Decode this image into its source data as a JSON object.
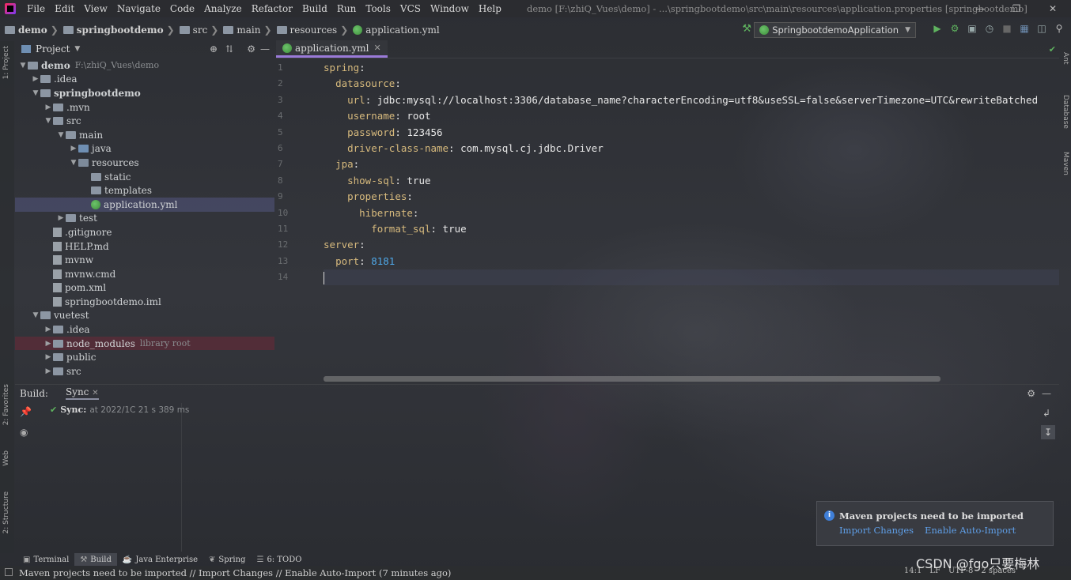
{
  "menu": [
    "File",
    "Edit",
    "View",
    "Navigate",
    "Code",
    "Analyze",
    "Refactor",
    "Build",
    "Run",
    "Tools",
    "VCS",
    "Window",
    "Help"
  ],
  "window_title": "demo [F:\\zhiQ_Vues\\demo] - ...\\springbootdemo\\src\\main\\resources\\application.properties [springbootdemo]",
  "breadcrumbs": [
    "demo",
    "springbootdemo",
    "src",
    "main",
    "resources",
    "application.yml"
  ],
  "run_config": "SpringbootdemoApplication",
  "project_panel": {
    "title": "Project",
    "tree": [
      {
        "depth": 0,
        "arrow": "▼",
        "name": "demo",
        "extra": "F:\\zhiQ_Vues\\demo",
        "bold": true,
        "type": "folder"
      },
      {
        "depth": 1,
        "arrow": "▶",
        "name": ".idea",
        "type": "folder"
      },
      {
        "depth": 1,
        "arrow": "▼",
        "name": "springbootdemo",
        "bold": true,
        "type": "folder"
      },
      {
        "depth": 2,
        "arrow": "▶",
        "name": ".mvn",
        "type": "folder"
      },
      {
        "depth": 2,
        "arrow": "▼",
        "name": "src",
        "type": "folder"
      },
      {
        "depth": 3,
        "arrow": "▼",
        "name": "main",
        "type": "folder"
      },
      {
        "depth": 4,
        "arrow": "▶",
        "name": "java",
        "type": "src"
      },
      {
        "depth": 4,
        "arrow": "▼",
        "name": "resources",
        "type": "res"
      },
      {
        "depth": 5,
        "arrow": "",
        "name": "static",
        "type": "folder"
      },
      {
        "depth": 5,
        "arrow": "",
        "name": "templates",
        "type": "folder"
      },
      {
        "depth": 5,
        "arrow": "",
        "name": "application.yml",
        "type": "yml",
        "selected": true
      },
      {
        "depth": 3,
        "arrow": "▶",
        "name": "test",
        "type": "folder"
      },
      {
        "depth": 2,
        "arrow": "",
        "name": ".gitignore",
        "type": "file"
      },
      {
        "depth": 2,
        "arrow": "",
        "name": "HELP.md",
        "type": "file"
      },
      {
        "depth": 2,
        "arrow": "",
        "name": "mvnw",
        "type": "file"
      },
      {
        "depth": 2,
        "arrow": "",
        "name": "mvnw.cmd",
        "type": "file"
      },
      {
        "depth": 2,
        "arrow": "",
        "name": "pom.xml",
        "type": "file"
      },
      {
        "depth": 2,
        "arrow": "",
        "name": "springbootdemo.iml",
        "type": "file"
      },
      {
        "depth": 1,
        "arrow": "▼",
        "name": "vuetest",
        "type": "folder"
      },
      {
        "depth": 2,
        "arrow": "▶",
        "name": ".idea",
        "type": "folder"
      },
      {
        "depth": 2,
        "arrow": "▶",
        "name": "node_modules",
        "extra": "library root",
        "type": "folder",
        "excluded": true
      },
      {
        "depth": 2,
        "arrow": "▶",
        "name": "public",
        "type": "folder"
      },
      {
        "depth": 2,
        "arrow": "▶",
        "name": "src",
        "type": "folder"
      }
    ]
  },
  "editor": {
    "tab_label": "application.yml",
    "lines": [
      {
        "n": "1",
        "parts": [
          [
            "key",
            "spring"
          ],
          [
            "kw",
            ":"
          ]
        ]
      },
      {
        "n": "2",
        "parts": [
          [
            "kw",
            "  "
          ],
          [
            "key",
            "datasource"
          ],
          [
            "kw",
            ":"
          ]
        ]
      },
      {
        "n": "3",
        "parts": [
          [
            "kw",
            "    "
          ],
          [
            "key",
            "url"
          ],
          [
            "kw",
            ": "
          ],
          [
            "val",
            "jdbc:mysql://localhost:3306/database_name?characterEncoding=utf8&useSSL=false&serverTimezone=UTC&rewriteBatched"
          ]
        ]
      },
      {
        "n": "4",
        "parts": [
          [
            "kw",
            "    "
          ],
          [
            "key",
            "username"
          ],
          [
            "kw",
            ": "
          ],
          [
            "val",
            "root"
          ]
        ]
      },
      {
        "n": "5",
        "parts": [
          [
            "kw",
            "    "
          ],
          [
            "key",
            "password"
          ],
          [
            "kw",
            ": "
          ],
          [
            "val",
            "123456"
          ]
        ]
      },
      {
        "n": "6",
        "parts": [
          [
            "kw",
            "    "
          ],
          [
            "key",
            "driver-class-name"
          ],
          [
            "kw",
            ": "
          ],
          [
            "val",
            "com.mysql.cj.jdbc.Driver"
          ]
        ]
      },
      {
        "n": "7",
        "parts": [
          [
            "kw",
            "  "
          ],
          [
            "key",
            "jpa"
          ],
          [
            "kw",
            ":"
          ]
        ]
      },
      {
        "n": "8",
        "parts": [
          [
            "kw",
            "    "
          ],
          [
            "key",
            "show-sql"
          ],
          [
            "kw",
            ": "
          ],
          [
            "val",
            "true"
          ]
        ]
      },
      {
        "n": "9",
        "parts": [
          [
            "kw",
            "    "
          ],
          [
            "key",
            "properties"
          ],
          [
            "kw",
            ":"
          ]
        ]
      },
      {
        "n": "10",
        "parts": [
          [
            "kw",
            "      "
          ],
          [
            "key",
            "hibernate"
          ],
          [
            "kw",
            ":"
          ]
        ]
      },
      {
        "n": "11",
        "parts": [
          [
            "kw",
            "        "
          ],
          [
            "key",
            "format_sql"
          ],
          [
            "kw",
            ": "
          ],
          [
            "val",
            "true"
          ]
        ]
      },
      {
        "n": "12",
        "parts": [
          [
            "key",
            "server"
          ],
          [
            "kw",
            ":"
          ]
        ]
      },
      {
        "n": "13",
        "parts": [
          [
            "kw",
            "  "
          ],
          [
            "key",
            "port"
          ],
          [
            "kw",
            ": "
          ],
          [
            "num",
            "8181"
          ]
        ]
      },
      {
        "n": "14",
        "parts": [],
        "current": true
      }
    ]
  },
  "build_panel": {
    "label": "Build:",
    "tab": "Sync",
    "sync_title": "Sync:",
    "sync_time": "at 2022/1C 21 s 389 ms"
  },
  "notification": {
    "title": "Maven projects need to be imported",
    "link_import": "Import Changes",
    "link_auto": "Enable Auto-Import"
  },
  "bottom_tabs": [
    {
      "label": "Terminal",
      "icon": "terminal-icon"
    },
    {
      "label": "Build",
      "icon": "hammer-icon",
      "active": true
    },
    {
      "label": "Java Enterprise",
      "icon": "java-icon"
    },
    {
      "label": "Spring",
      "icon": "leaf-icon"
    },
    {
      "label": "6: TODO",
      "icon": "todo-icon"
    }
  ],
  "status": {
    "message": "Maven projects need to be imported // Import Changes // Enable Auto-Import (7 minutes ago)",
    "position": "14:1",
    "line_sep": "LF",
    "encoding": "UTF-8",
    "indent": "2 spaces"
  },
  "side_tabs": {
    "left": [
      "1: Project",
      "2: Favorites",
      "Web",
      "2: Structure"
    ],
    "right": [
      "Ant",
      "Database",
      "Maven"
    ]
  },
  "watermark": "CSDN @fgo只要梅林",
  "colors": {
    "accent": "#9a7ad8",
    "link": "#5f9fe8",
    "number": "#4fa8e8",
    "key": "#d7ba7d",
    "ok": "#5fb35f"
  }
}
